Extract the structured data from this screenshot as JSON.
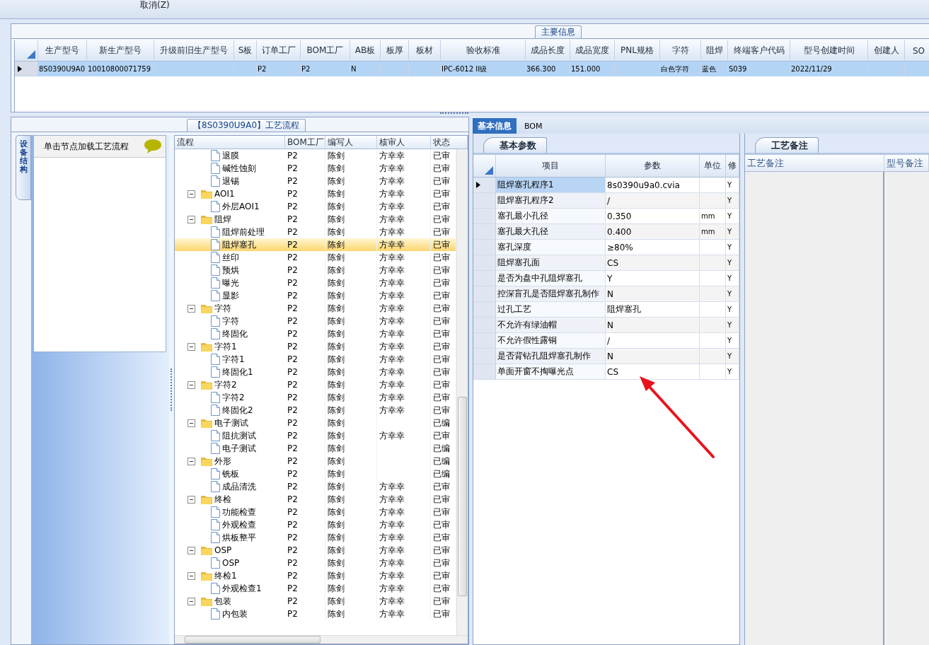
{
  "toolbar": {
    "cancel_button": "取消(Z)"
  },
  "main_info": {
    "title": "主要信息",
    "columns": [
      "生产型号",
      "新生产型号",
      "升级前旧生产型号",
      "S板",
      "订单工厂",
      "BOM工厂",
      "AB板",
      "板厚",
      "板材",
      "验收标准",
      "成品长度",
      "成品宽度",
      "PNL规格",
      "字符",
      "阻焊",
      "终端客户代码",
      "型号创建时间",
      "创建人",
      "SO"
    ],
    "rows": [
      {
        "selected": true,
        "cells": [
          "8S0390U9A0",
          "10010800071759",
          null,
          null,
          "P2",
          "P2",
          "N",
          null,
          null,
          "IPC-6012 II级",
          "366.300",
          "151.000",
          null,
          "白色字符",
          "蓝色",
          "S039",
          "2022/11/29",
          null,
          null
        ]
      }
    ]
  },
  "process_panel": {
    "title": "【8S0390U9A0】工艺流程",
    "side_tab": "设备结构",
    "node_hint": "单击节点加载工艺流程",
    "columns": [
      "流程",
      "BOM工厂",
      "编写人",
      "核审人",
      "状态"
    ],
    "continued_children": [
      {
        "kind": "file",
        "name": "退膜",
        "bom": "P2",
        "writer": "陈剑",
        "reviewer": "方幸幸",
        "status": "已审",
        "selected": false
      },
      {
        "kind": "file",
        "name": "碱性蚀刻",
        "bom": "P2",
        "writer": "陈剑",
        "reviewer": "方幸幸",
        "status": "已审",
        "selected": false
      },
      {
        "kind": "file",
        "name": "退锡",
        "bom": "P2",
        "writer": "陈剑",
        "reviewer": "方幸幸",
        "status": "已审",
        "selected": false
      }
    ],
    "nodes": [
      {
        "kind": "folder",
        "name": "AOI1",
        "bom": "P2",
        "writer": "陈剑",
        "reviewer": "方幸幸",
        "status": "已审",
        "selected": false,
        "expanded": true,
        "children": [
          {
            "kind": "file",
            "name": "外层AOI1",
            "bom": "P2",
            "writer": "陈剑",
            "reviewer": "方幸幸",
            "status": "已审",
            "selected": false
          }
        ]
      },
      {
        "kind": "folder",
        "name": "阻焊",
        "bom": "P2",
        "writer": "陈剑",
        "reviewer": "方幸幸",
        "status": "已审",
        "selected": false,
        "expanded": true,
        "children": [
          {
            "kind": "file",
            "name": "阻焊前处理",
            "bom": "P2",
            "writer": "陈剑",
            "reviewer": "方幸幸",
            "status": "已审",
            "selected": false
          },
          {
            "kind": "file",
            "name": "阻焊塞孔",
            "bom": "P2",
            "writer": "陈剑",
            "reviewer": "方幸幸",
            "status": "已审",
            "selected": true
          },
          {
            "kind": "file",
            "name": "丝印",
            "bom": "P2",
            "writer": "陈剑",
            "reviewer": "方幸幸",
            "status": "已审",
            "selected": false
          },
          {
            "kind": "file",
            "name": "预烘",
            "bom": "P2",
            "writer": "陈剑",
            "reviewer": "方幸幸",
            "status": "已审",
            "selected": false
          },
          {
            "kind": "file",
            "name": "曝光",
            "bom": "P2",
            "writer": "陈剑",
            "reviewer": "方幸幸",
            "status": "已审",
            "selected": false
          },
          {
            "kind": "file",
            "name": "显影",
            "bom": "P2",
            "writer": "陈剑",
            "reviewer": "方幸幸",
            "status": "已审",
            "selected": false
          }
        ]
      },
      {
        "kind": "folder",
        "name": "字符",
        "bom": "P2",
        "writer": "陈剑",
        "reviewer": "方幸幸",
        "status": "已审",
        "selected": false,
        "expanded": true,
        "children": [
          {
            "kind": "file",
            "name": "字符",
            "bom": "P2",
            "writer": "陈剑",
            "reviewer": "方幸幸",
            "status": "已审",
            "selected": false
          },
          {
            "kind": "file",
            "name": "终固化",
            "bom": "P2",
            "writer": "陈剑",
            "reviewer": "方幸幸",
            "status": "已审",
            "selected": false
          }
        ]
      },
      {
        "kind": "folder",
        "name": "字符1",
        "bom": "P2",
        "writer": "陈剑",
        "reviewer": "方幸幸",
        "status": "已审",
        "selected": false,
        "expanded": true,
        "children": [
          {
            "kind": "file",
            "name": "字符1",
            "bom": "P2",
            "writer": "陈剑",
            "reviewer": "方幸幸",
            "status": "已审",
            "selected": false
          },
          {
            "kind": "file",
            "name": "终固化1",
            "bom": "P2",
            "writer": "陈剑",
            "reviewer": "方幸幸",
            "status": "已审",
            "selected": false
          }
        ]
      },
      {
        "kind": "folder",
        "name": "字符2",
        "bom": "P2",
        "writer": "陈剑",
        "reviewer": "方幸幸",
        "status": "已审",
        "selected": false,
        "expanded": true,
        "children": [
          {
            "kind": "file",
            "name": "字符2",
            "bom": "P2",
            "writer": "陈剑",
            "reviewer": "方幸幸",
            "status": "已审",
            "selected": false
          },
          {
            "kind": "file",
            "name": "终固化2",
            "bom": "P2",
            "writer": "陈剑",
            "reviewer": "方幸幸",
            "status": "已审",
            "selected": false
          }
        ]
      },
      {
        "kind": "folder",
        "name": "电子测试",
        "bom": "P2",
        "writer": "陈剑",
        "status": "已编",
        "selected": false,
        "expanded": true,
        "children": [
          {
            "kind": "file",
            "name": "阻抗测试",
            "bom": "P2",
            "writer": "陈剑",
            "reviewer": "方幸幸",
            "status": "已审",
            "selected": false
          },
          {
            "kind": "file",
            "name": "电子测试",
            "bom": "P2",
            "writer": "陈剑",
            "status": "已编",
            "selected": false
          }
        ]
      },
      {
        "kind": "folder",
        "name": "外形",
        "bom": "P2",
        "writer": "陈剑",
        "status": "已编",
        "selected": false,
        "expanded": true,
        "children": [
          {
            "kind": "file",
            "name": "铣板",
            "bom": "P2",
            "writer": "陈剑",
            "status": "已编",
            "selected": false
          },
          {
            "kind": "file",
            "name": "成品清洗",
            "bom": "P2",
            "writer": "陈剑",
            "reviewer": "方幸幸",
            "status": "已审",
            "selected": false
          }
        ]
      },
      {
        "kind": "folder",
        "name": "终检",
        "bom": "P2",
        "writer": "陈剑",
        "reviewer": "方幸幸",
        "status": "已审",
        "selected": false,
        "expanded": true,
        "children": [
          {
            "kind": "file",
            "name": "功能检查",
            "bom": "P2",
            "writer": "陈剑",
            "reviewer": "方幸幸",
            "status": "已审",
            "selected": false
          },
          {
            "kind": "file",
            "name": "外观检查",
            "bom": "P2",
            "writer": "陈剑",
            "reviewer": "方幸幸",
            "status": "已审",
            "selected": false
          },
          {
            "kind": "file",
            "name": "烘板整平",
            "bom": "P2",
            "writer": "陈剑",
            "reviewer": "方幸幸",
            "status": "已审",
            "selected": false
          }
        ]
      },
      {
        "kind": "folder",
        "name": "OSP",
        "bom": "P2",
        "writer": "陈剑",
        "reviewer": "方幸幸",
        "status": "已审",
        "selected": false,
        "expanded": true,
        "children": [
          {
            "kind": "file",
            "name": "OSP",
            "bom": "P2",
            "writer": "陈剑",
            "reviewer": "方幸幸",
            "status": "已审",
            "selected": false
          }
        ]
      },
      {
        "kind": "folder",
        "name": "终检1",
        "bom": "P2",
        "writer": "陈剑",
        "reviewer": "方幸幸",
        "status": "已审",
        "selected": false,
        "expanded": true,
        "children": [
          {
            "kind": "file",
            "name": "外观检查1",
            "bom": "P2",
            "writer": "陈剑",
            "reviewer": "方幸幸",
            "status": "已审",
            "selected": false
          }
        ]
      },
      {
        "kind": "folder",
        "name": "包装",
        "bom": "P2",
        "writer": "陈剑",
        "reviewer": "方幸幸",
        "status": "已审",
        "selected": false,
        "expanded": true,
        "children": [
          {
            "kind": "file",
            "name": "内包装",
            "bom": "P2",
            "writer": "陈剑",
            "reviewer": "方幸幸",
            "status": "已审",
            "selected": false
          }
        ]
      }
    ]
  },
  "detail_tabs": [
    {
      "label": "基本信息",
      "selected": true
    },
    {
      "label": "BOM",
      "selected": false
    }
  ],
  "params_panel": {
    "tab": "基本参数",
    "columns": [
      "项目",
      "参数",
      "单位",
      "修"
    ],
    "rows": [
      {
        "item": "阻焊塞孔程序1",
        "value": "8s0390u9a0.cvia",
        "modify": "Y",
        "selected": true
      },
      {
        "item": "阻焊塞孔程序2",
        "value": "/",
        "modify": "Y",
        "selected": false
      },
      {
        "item": "塞孔最小孔径",
        "value": "0.350",
        "unit": "mm",
        "modify": "Y",
        "selected": false
      },
      {
        "item": "塞孔最大孔径",
        "value": "0.400",
        "unit": "mm",
        "modify": "Y",
        "selected": false
      },
      {
        "item": "塞孔深度",
        "value": "≥80%",
        "modify": "Y",
        "selected": false
      },
      {
        "item": "阻焊塞孔面",
        "value": "CS",
        "modify": "Y",
        "selected": false
      },
      {
        "item": "是否为盘中孔阻焊塞孔",
        "value": "Y",
        "modify": "Y",
        "selected": false
      },
      {
        "item": "控深盲孔是否阻焊塞孔制作",
        "value": "N",
        "modify": "Y",
        "selected": false
      },
      {
        "item": "过孔工艺",
        "value": "阻焊塞孔",
        "modify": "Y",
        "selected": false
      },
      {
        "item": "不允许有绿油帽",
        "value": "N",
        "modify": "Y",
        "selected": false
      },
      {
        "item": "不允许假性露铜",
        "value": "/",
        "modify": "Y",
        "selected": false
      },
      {
        "item": "是否背钻孔阻焊塞孔制作",
        "value": "N",
        "modify": "Y",
        "selected": false
      },
      {
        "item": "单面开窗不掏曝光点",
        "value": "CS",
        "modify": "Y",
        "selected": false
      }
    ]
  },
  "notes_panel": {
    "tab": "工艺备注",
    "columns": [
      "工艺备注",
      "型号备注"
    ]
  }
}
